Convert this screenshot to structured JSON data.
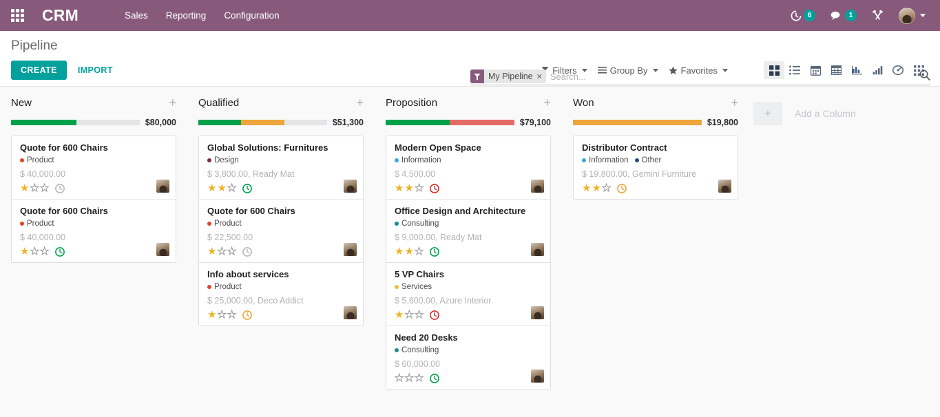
{
  "navbar": {
    "apps_icon": "apps-grid-icon",
    "brand": "CRM",
    "menu": [
      {
        "label": "Sales"
      },
      {
        "label": "Reporting"
      },
      {
        "label": "Configuration"
      }
    ],
    "activity": {
      "icon": "clock-activity-icon",
      "count": "6"
    },
    "messages": {
      "icon": "chat-bubble-icon",
      "count": "1"
    },
    "tools": {
      "icon": "wrench-screwdriver-icon"
    },
    "user": {
      "icon": "avatar-icon",
      "caret": "chevron-down-icon"
    }
  },
  "control_panel": {
    "page_title": "Pipeline",
    "create_label": "CREATE",
    "import_label": "IMPORT",
    "search": {
      "facet_icon": "filter-funnel-icon",
      "facet_label": "My Pipeline",
      "facet_remove": "✕",
      "placeholder": "Search...",
      "value": "",
      "magnifier_icon": "search-icon"
    },
    "dropdowns": [
      {
        "label": "Filters",
        "icon": "filter-funnel-icon",
        "name": "filters"
      },
      {
        "label": "Group By",
        "icon": "list-lines-icon",
        "name": "group-by"
      },
      {
        "label": "Favorites",
        "icon": "star-icon",
        "name": "favorites"
      }
    ],
    "views": [
      {
        "name": "kanban",
        "icon": "kanban-icon",
        "active": true
      },
      {
        "name": "list",
        "icon": "list-icon",
        "active": false
      },
      {
        "name": "calendar",
        "icon": "calendar-icon",
        "active": false
      },
      {
        "name": "pivot",
        "icon": "pivot-table-icon",
        "active": false
      },
      {
        "name": "graph",
        "icon": "bar-chart-icon",
        "active": false
      },
      {
        "name": "chart",
        "icon": "ascending-bars-icon",
        "active": false
      },
      {
        "name": "dashboard",
        "icon": "gauge-icon",
        "active": false
      },
      {
        "name": "activity",
        "icon": "grid-dots-icon",
        "active": false
      }
    ]
  },
  "colors": {
    "brand_purple": "#875a7b",
    "accent_teal": "#00A09D",
    "progress_green": "#00a14b",
    "progress_orange": "#f0a councils",
    "star_gold": "#f0b323"
  },
  "kanban": {
    "add_column": {
      "label": "Add a Column",
      "icon": "plus-icon"
    },
    "columns": [
      {
        "title": "New",
        "amount": "$80,000",
        "add_icon": "plus-icon",
        "progress": [
          {
            "color": "#00a14b",
            "pct": 51
          },
          {
            "color": "#e3e5e7",
            "pct": 49
          }
        ],
        "cards": [
          {
            "title": "Quote for 600 Chairs",
            "tags": [
              {
                "label": "Product",
                "color": "#e0462e"
              }
            ],
            "amount": "$ 40,000.00",
            "stars": 1,
            "clock_color": "#b7b7b7",
            "avatar": "user-avatar"
          },
          {
            "title": "Quote for 600 Chairs",
            "tags": [
              {
                "label": "Product",
                "color": "#e0462e"
              }
            ],
            "amount": "$ 40,000.00",
            "stars": 1,
            "clock_color": "#00a14b",
            "avatar": "user-avatar"
          }
        ]
      },
      {
        "title": "Qualified",
        "amount": "$51,300",
        "add_icon": "plus-icon",
        "progress": [
          {
            "color": "#00a14b",
            "pct": 33
          },
          {
            "color": "#eda53c",
            "pct": 34
          },
          {
            "color": "#e3e5e7",
            "pct": 33
          }
        ],
        "cards": [
          {
            "title": "Global Solutions: Furnitures",
            "tags": [
              {
                "label": "Design",
                "color": "#7b2b4a"
              }
            ],
            "amount": "$ 3,800.00, Ready Mat",
            "stars": 2,
            "clock_color": "#00a14b",
            "avatar": "user-avatar"
          },
          {
            "title": "Quote for 600 Chairs",
            "tags": [
              {
                "label": "Product",
                "color": "#e0462e"
              }
            ],
            "amount": "$ 22,500.00",
            "stars": 1,
            "clock_color": "#b7b7b7",
            "avatar": "user-avatar"
          },
          {
            "title": "Info about services",
            "tags": [
              {
                "label": "Product",
                "color": "#e0462e"
              }
            ],
            "amount": "$ 25,000.00, Deco Addict",
            "stars": 1,
            "clock_color": "#eda53c",
            "avatar": "user-avatar"
          }
        ]
      },
      {
        "title": "Proposition",
        "amount": "$79,100",
        "add_icon": "plus-icon",
        "progress": [
          {
            "color": "#00a14b",
            "pct": 50
          },
          {
            "color": "#e46a65",
            "pct": 50
          }
        ],
        "cards": [
          {
            "title": "Modern Open Space",
            "tags": [
              {
                "label": "Information",
                "color": "#3ba7e0"
              }
            ],
            "amount": "$ 4,500.00",
            "stars": 2,
            "clock_color": "#d9302c",
            "avatar": "user-avatar"
          },
          {
            "title": "Office Design and Architecture",
            "tags": [
              {
                "label": "Consulting",
                "color": "#1f8a8f"
              }
            ],
            "amount": "$ 9,000.00, Ready Mat",
            "stars": 2,
            "clock_color": "#00a14b",
            "avatar": "user-avatar"
          },
          {
            "title": "5 VP Chairs",
            "tags": [
              {
                "label": "Services",
                "color": "#e8c13a"
              }
            ],
            "amount": "$ 5,600.00, Azure Interior",
            "stars": 1,
            "clock_color": "#d9302c",
            "avatar": "user-avatar"
          },
          {
            "title": "Need 20 Desks",
            "tags": [
              {
                "label": "Consulting",
                "color": "#1f8a8f"
              }
            ],
            "amount": "$ 60,000.00",
            "stars": 0,
            "clock_color": "#00a14b",
            "avatar": "user-avatar"
          }
        ]
      },
      {
        "title": "Won",
        "amount": "$19,800",
        "add_icon": "plus-icon",
        "progress": [
          {
            "color": "#eda53c",
            "pct": 100
          }
        ],
        "cards": [
          {
            "title": "Distributor Contract",
            "tags": [
              {
                "label": "Information",
                "color": "#3ba7e0"
              },
              {
                "label": "Other",
                "color": "#2c4b7c"
              }
            ],
            "amount": "$ 19,800.00, Gemini Furniture",
            "stars": 2,
            "clock_color": "#eda53c",
            "avatar": "user-avatar"
          }
        ]
      }
    ]
  }
}
